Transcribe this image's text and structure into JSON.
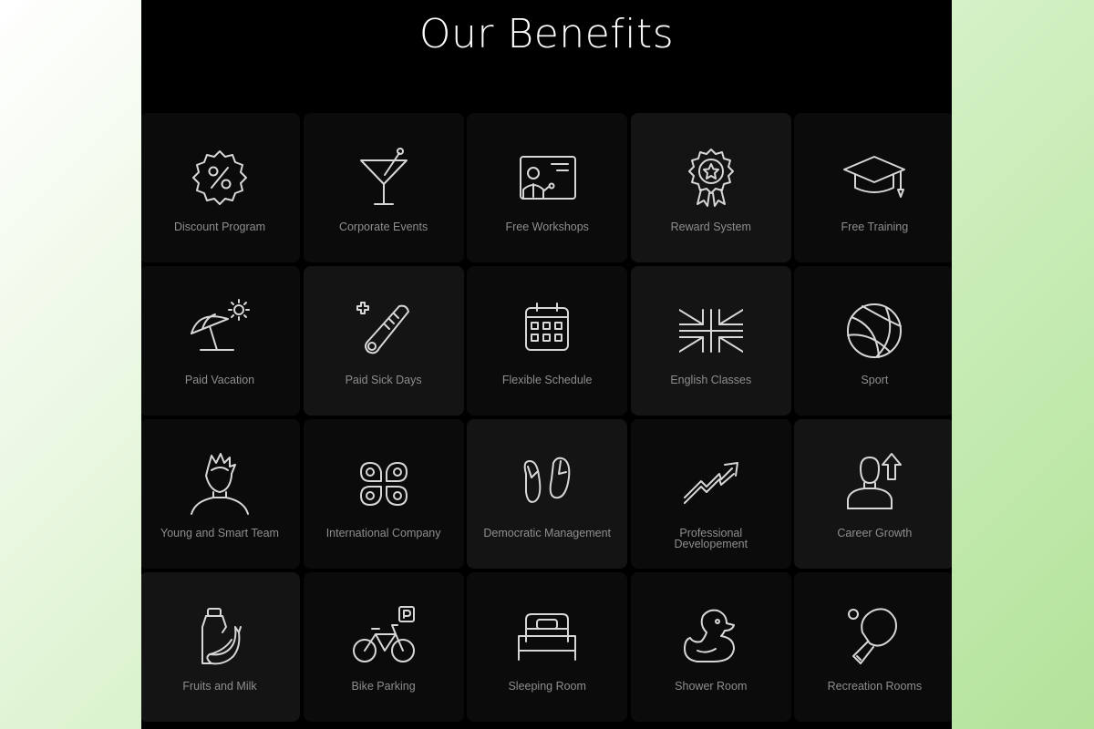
{
  "page": {
    "title": "Our Benefits"
  },
  "benefits": [
    {
      "label": "Discount Program",
      "icon": "discount-badge-icon"
    },
    {
      "label": "Corporate Events",
      "icon": "cocktail-icon"
    },
    {
      "label": "Free Workshops",
      "icon": "presentation-board-icon"
    },
    {
      "label": "Reward System",
      "icon": "award-medal-icon"
    },
    {
      "label": "Free Training",
      "icon": "graduation-cap-icon"
    },
    {
      "label": "Paid Vacation",
      "icon": "beach-umbrella-icon"
    },
    {
      "label": "Paid Sick Days",
      "icon": "thermometer-icon"
    },
    {
      "label": "Flexible Schedule",
      "icon": "calendar-icon"
    },
    {
      "label": "English Classes",
      "icon": "uk-flag-icon"
    },
    {
      "label": "Sport",
      "icon": "basketball-icon"
    },
    {
      "label": "Young and Smart Team",
      "icon": "young-person-icon"
    },
    {
      "label": "International Company",
      "icon": "butterfly-pins-icon"
    },
    {
      "label": "Democratic Management",
      "icon": "flip-flops-icon"
    },
    {
      "label": "Professional\nDevelopement",
      "icon": "growth-arrow-icon"
    },
    {
      "label": "Career Growth",
      "icon": "person-arrow-up-icon"
    },
    {
      "label": "Fruits and Milk",
      "icon": "milk-banana-icon"
    },
    {
      "label": "Bike Parking",
      "icon": "bicycle-parking-icon"
    },
    {
      "label": "Sleeping Room",
      "icon": "bed-icon"
    },
    {
      "label": "Shower Room",
      "icon": "rubber-duck-icon"
    },
    {
      "label": "Recreation Rooms",
      "icon": "ping-pong-icon"
    }
  ]
}
